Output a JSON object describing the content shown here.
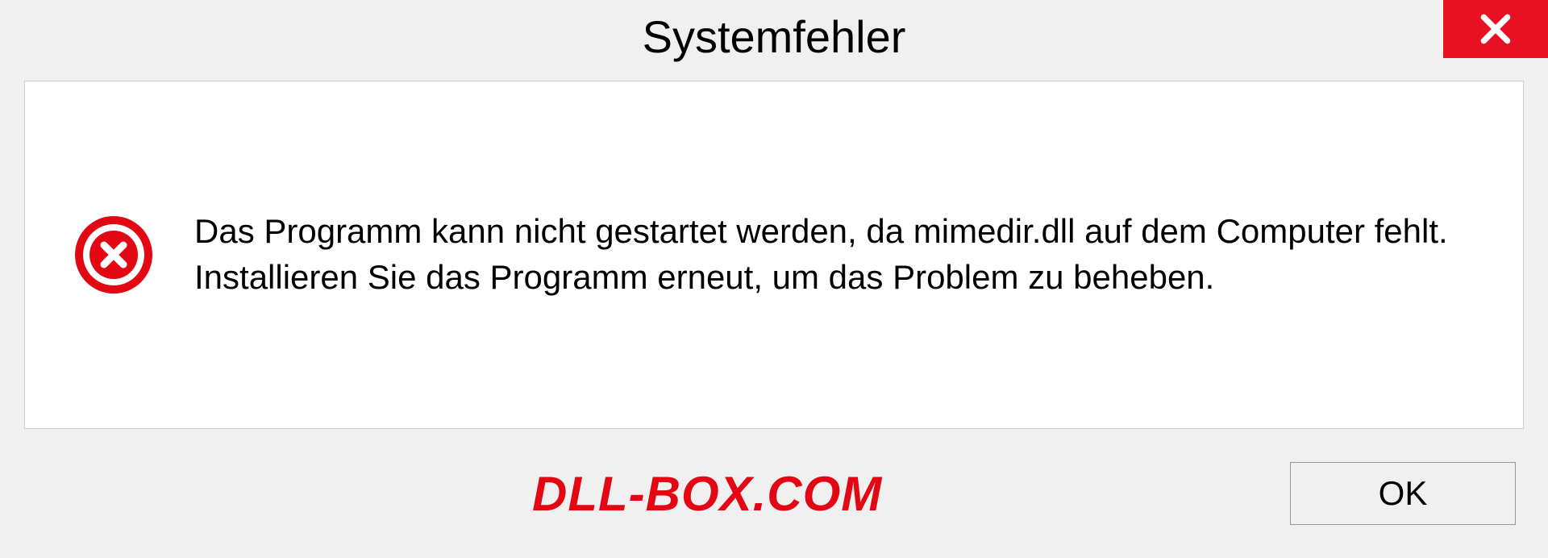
{
  "dialog": {
    "title": "Systemfehler",
    "message": "Das Programm kann nicht gestartet werden, da mimedir.dll auf dem Computer fehlt. Installieren Sie das Programm erneut, um das Problem zu beheben.",
    "ok_label": "OK"
  },
  "watermark": "DLL-BOX.COM"
}
